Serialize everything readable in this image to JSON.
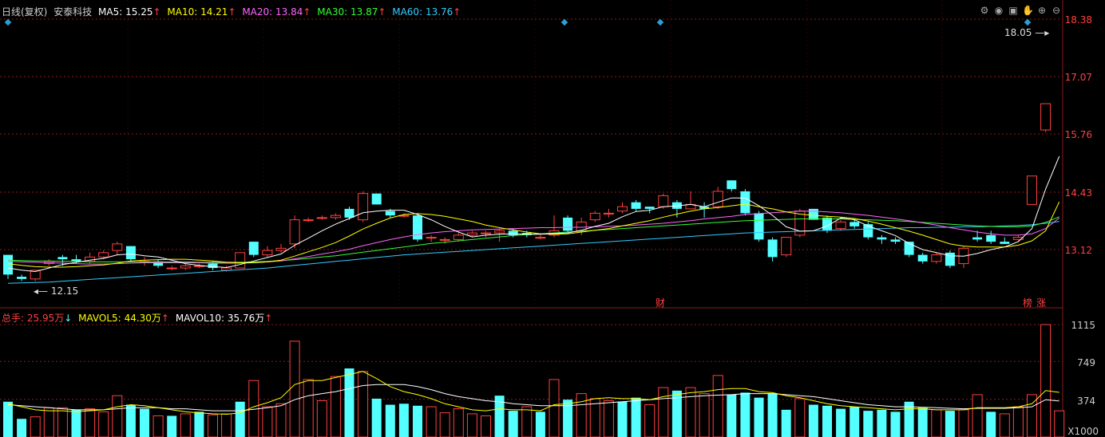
{
  "header": {
    "period_label": "日线(复权)",
    "stock_name": "安泰科技",
    "ma5": {
      "label": "MA5:",
      "value": "15.25",
      "arrow": "↑",
      "color": "#ffffff"
    },
    "ma10": {
      "label": "MA10:",
      "value": "14.21",
      "arrow": "↑",
      "color": "#ffff00"
    },
    "ma20": {
      "label": "MA20:",
      "value": "13.84",
      "arrow": "↑",
      "color": "#ff66ff"
    },
    "ma30": {
      "label": "MA30:",
      "value": "13.87",
      "arrow": "↑",
      "color": "#33ff33"
    },
    "ma60": {
      "label": "MA60:",
      "value": "13.76",
      "arrow": "↑",
      "color": "#33ccff"
    }
  },
  "vol_header": {
    "total": {
      "label": "总手:",
      "value": "25.95万",
      "arrow": "↓",
      "color": "#ff4040"
    },
    "mavol5": {
      "label": "MAVOL5:",
      "value": "44.30万",
      "arrow": "↑",
      "color": "#ffff00"
    },
    "mavol10": {
      "label": "MAVOL10:",
      "value": "35.76万",
      "arrow": "↑",
      "color": "#ffffff"
    }
  },
  "toolbar_icons": [
    "gear-icon",
    "eye-icon",
    "box-icon",
    "hand-icon",
    "zoom-in-icon",
    "zoom-out-icon"
  ],
  "markers": {
    "cai": "财",
    "bang": "榜",
    "zhang": "涨"
  },
  "annotations": {
    "high": "18.05",
    "low": "12.15"
  },
  "chart_data": {
    "type": "candlestick",
    "price_axis": {
      "min": 12.15,
      "max": 18.38,
      "ticks": [
        18.38,
        17.07,
        15.76,
        14.43,
        13.12
      ]
    },
    "volume_axis": {
      "min": 0,
      "max": 1115,
      "ticks": [
        1115,
        749,
        374
      ],
      "unit": "X1000"
    },
    "colors": {
      "up": "#ff4040",
      "down": "#54ffff",
      "ma5": "#ffffff",
      "ma10": "#ffff00",
      "ma20": "#ff66ff",
      "ma30": "#33ff33",
      "ma60": "#33ccff",
      "grid": "#8b1a1a"
    },
    "candles": [
      [
        13.0,
        12.55,
        13.0,
        12.45
      ],
      [
        12.5,
        12.45,
        12.55,
        12.4
      ],
      [
        12.45,
        12.65,
        12.65,
        12.4
      ],
      [
        12.8,
        12.85,
        12.9,
        12.75
      ],
      [
        12.95,
        12.9,
        13.0,
        12.75
      ],
      [
        12.9,
        12.85,
        13.0,
        12.8
      ],
      [
        12.85,
        12.95,
        13.05,
        12.8
      ],
      [
        12.95,
        13.05,
        13.1,
        12.9
      ],
      [
        13.1,
        13.25,
        13.3,
        13.0
      ],
      [
        13.2,
        12.9,
        13.2,
        12.85
      ],
      [
        12.85,
        12.85,
        12.95,
        12.75
      ],
      [
        12.85,
        12.75,
        12.9,
        12.7
      ],
      [
        12.7,
        12.7,
        12.75,
        12.65
      ],
      [
        12.7,
        12.75,
        12.8,
        12.65
      ],
      [
        12.75,
        12.75,
        12.8,
        12.7
      ],
      [
        12.8,
        12.7,
        12.85,
        12.65
      ],
      [
        12.65,
        12.7,
        12.75,
        12.62
      ],
      [
        12.7,
        13.05,
        13.05,
        12.7
      ],
      [
        13.3,
        13.0,
        13.3,
        12.95
      ],
      [
        13.0,
        13.1,
        13.2,
        12.95
      ],
      [
        13.1,
        13.15,
        13.25,
        13.05
      ],
      [
        13.25,
        13.8,
        13.9,
        13.15
      ],
      [
        13.8,
        13.8,
        13.85,
        13.75
      ],
      [
        13.85,
        13.85,
        13.9,
        13.8
      ],
      [
        13.85,
        13.9,
        13.95,
        13.8
      ],
      [
        14.05,
        13.85,
        14.1,
        13.8
      ],
      [
        13.8,
        14.4,
        14.45,
        13.75
      ],
      [
        14.4,
        14.15,
        14.4,
        14.15
      ],
      [
        14.0,
        13.9,
        14.05,
        13.85
      ],
      [
        13.9,
        13.9,
        13.95,
        13.85
      ],
      [
        13.9,
        13.35,
        13.95,
        13.3
      ],
      [
        13.4,
        13.4,
        13.45,
        13.3
      ],
      [
        13.35,
        13.35,
        13.4,
        13.25
      ],
      [
        13.35,
        13.45,
        13.5,
        13.3
      ],
      [
        13.45,
        13.5,
        13.55,
        13.4
      ],
      [
        13.5,
        13.5,
        13.55,
        13.4
      ],
      [
        13.5,
        13.55,
        13.6,
        13.3
      ],
      [
        13.55,
        13.45,
        13.6,
        13.4
      ],
      [
        13.5,
        13.45,
        13.55,
        13.4
      ],
      [
        13.4,
        13.4,
        13.45,
        13.35
      ],
      [
        13.45,
        13.55,
        13.9,
        13.4
      ],
      [
        13.85,
        13.55,
        13.9,
        13.5
      ],
      [
        13.55,
        13.75,
        13.85,
        13.45
      ],
      [
        13.8,
        13.95,
        14.0,
        13.75
      ],
      [
        13.95,
        13.95,
        14.05,
        13.85
      ],
      [
        14.0,
        14.1,
        14.2,
        13.95
      ],
      [
        14.2,
        14.05,
        14.25,
        14.0
      ],
      [
        14.1,
        14.05,
        14.1,
        13.95
      ],
      [
        14.1,
        14.35,
        14.4,
        14.05
      ],
      [
        14.2,
        14.05,
        14.25,
        13.85
      ],
      [
        14.05,
        14.15,
        14.45,
        14.05
      ],
      [
        14.1,
        14.05,
        14.2,
        13.85
      ],
      [
        14.1,
        14.45,
        14.55,
        14.05
      ],
      [
        14.7,
        14.5,
        14.7,
        14.45
      ],
      [
        14.45,
        13.95,
        14.5,
        13.9
      ],
      [
        13.95,
        13.35,
        14.0,
        13.3
      ],
      [
        13.35,
        12.95,
        13.4,
        12.85
      ],
      [
        13.0,
        13.4,
        13.4,
        12.95
      ],
      [
        13.45,
        14.0,
        14.05,
        13.4
      ],
      [
        14.05,
        13.8,
        14.05,
        13.8
      ],
      [
        13.85,
        13.55,
        13.9,
        13.5
      ],
      [
        13.6,
        13.75,
        13.8,
        13.55
      ],
      [
        13.75,
        13.65,
        13.8,
        13.6
      ],
      [
        13.7,
        13.4,
        13.75,
        13.35
      ],
      [
        13.4,
        13.35,
        13.45,
        13.25
      ],
      [
        13.35,
        13.3,
        13.4,
        13.25
      ],
      [
        13.3,
        13.0,
        13.3,
        12.95
      ],
      [
        13.0,
        12.85,
        13.05,
        12.8
      ],
      [
        12.85,
        13.0,
        13.05,
        12.8
      ],
      [
        13.05,
        12.75,
        13.1,
        12.7
      ],
      [
        12.8,
        13.15,
        13.2,
        12.7
      ],
      [
        13.4,
        13.35,
        13.55,
        13.3
      ],
      [
        13.45,
        13.3,
        13.55,
        13.25
      ],
      [
        13.3,
        13.25,
        13.4,
        13.25
      ],
      [
        13.35,
        13.4,
        13.45,
        13.3
      ],
      [
        14.15,
        14.8,
        14.8,
        14.15
      ],
      [
        15.85,
        16.45,
        16.45,
        15.8
      ]
    ],
    "volumes": [
      [
        350,
        0
      ],
      [
        180,
        0
      ],
      [
        200,
        1
      ],
      [
        290,
        1
      ],
      [
        290,
        1
      ],
      [
        270,
        0
      ],
      [
        280,
        1
      ],
      [
        250,
        1
      ],
      [
        410,
        1
      ],
      [
        320,
        0
      ],
      [
        280,
        0
      ],
      [
        210,
        1
      ],
      [
        210,
        0
      ],
      [
        230,
        1
      ],
      [
        250,
        0
      ],
      [
        220,
        1
      ],
      [
        230,
        1
      ],
      [
        350,
        0
      ],
      [
        560,
        1
      ],
      [
        300,
        1
      ],
      [
        330,
        1
      ],
      [
        950,
        1
      ],
      [
        570,
        1
      ],
      [
        360,
        1
      ],
      [
        600,
        1
      ],
      [
        680,
        0
      ],
      [
        650,
        1
      ],
      [
        380,
        0
      ],
      [
        320,
        0
      ],
      [
        330,
        0
      ],
      [
        310,
        0
      ],
      [
        300,
        1
      ],
      [
        240,
        1
      ],
      [
        280,
        1
      ],
      [
        230,
        1
      ],
      [
        210,
        1
      ],
      [
        410,
        0
      ],
      [
        260,
        0
      ],
      [
        300,
        1
      ],
      [
        250,
        0
      ],
      [
        570,
        1
      ],
      [
        370,
        0
      ],
      [
        430,
        1
      ],
      [
        380,
        1
      ],
      [
        360,
        1
      ],
      [
        350,
        0
      ],
      [
        390,
        0
      ],
      [
        320,
        1
      ],
      [
        490,
        1
      ],
      [
        460,
        0
      ],
      [
        490,
        1
      ],
      [
        430,
        1
      ],
      [
        610,
        1
      ],
      [
        420,
        0
      ],
      [
        440,
        0
      ],
      [
        390,
        0
      ],
      [
        430,
        0
      ],
      [
        270,
        0
      ],
      [
        380,
        1
      ],
      [
        320,
        0
      ],
      [
        310,
        0
      ],
      [
        280,
        0
      ],
      [
        300,
        0
      ],
      [
        260,
        0
      ],
      [
        270,
        0
      ],
      [
        250,
        0
      ],
      [
        350,
        0
      ],
      [
        290,
        0
      ],
      [
        270,
        1
      ],
      [
        260,
        0
      ],
      [
        270,
        1
      ],
      [
        420,
        1
      ],
      [
        250,
        0
      ],
      [
        230,
        1
      ],
      [
        300,
        1
      ],
      [
        420,
        1
      ],
      [
        1115,
        1
      ],
      [
        260,
        1
      ]
    ],
    "ma": {
      "ma5": [
        12.7,
        12.65,
        12.62,
        12.7,
        12.78,
        12.83,
        12.88,
        12.92,
        13.0,
        13.02,
        12.98,
        12.95,
        12.88,
        12.8,
        12.76,
        12.73,
        12.71,
        12.78,
        12.86,
        12.94,
        13.02,
        13.22,
        13.38,
        13.55,
        13.7,
        13.83,
        13.96,
        14.0,
        14.02,
        14.02,
        13.92,
        13.8,
        13.65,
        13.52,
        13.41,
        13.45,
        13.47,
        13.48,
        13.47,
        13.47,
        13.49,
        13.5,
        13.56,
        13.65,
        13.72,
        13.87,
        13.99,
        14.02,
        14.1,
        14.12,
        14.15,
        14.1,
        14.2,
        14.3,
        14.3,
        14.12,
        13.9,
        13.64,
        13.54,
        13.55,
        13.66,
        13.84,
        13.8,
        13.66,
        13.55,
        13.44,
        13.26,
        13.12,
        13.05,
        12.98,
        12.97,
        13.03,
        13.12,
        13.18,
        13.3,
        13.6,
        14.5,
        15.25
      ],
      "ma10": [
        12.8,
        12.76,
        12.73,
        12.72,
        12.72,
        12.73,
        12.75,
        12.77,
        12.81,
        12.86,
        12.88,
        12.89,
        12.9,
        12.9,
        12.88,
        12.86,
        12.83,
        12.82,
        12.82,
        12.84,
        12.88,
        12.97,
        13.07,
        13.17,
        13.28,
        13.43,
        13.59,
        13.72,
        13.84,
        13.92,
        13.94,
        13.92,
        13.88,
        13.82,
        13.76,
        13.68,
        13.62,
        13.57,
        13.52,
        13.48,
        13.47,
        13.48,
        13.52,
        13.56,
        13.6,
        13.66,
        13.72,
        13.78,
        13.86,
        13.93,
        14.0,
        14.05,
        14.08,
        14.12,
        14.16,
        14.1,
        14.05,
        13.98,
        13.93,
        13.9,
        13.88,
        13.86,
        13.83,
        13.77,
        13.7,
        13.62,
        13.54,
        13.45,
        13.35,
        13.25,
        13.2,
        13.18,
        13.18,
        13.18,
        13.22,
        13.32,
        13.55,
        14.21
      ],
      "ma20": [
        12.85,
        12.84,
        12.83,
        12.82,
        12.81,
        12.8,
        12.79,
        12.79,
        12.8,
        12.81,
        12.82,
        12.82,
        12.82,
        12.82,
        12.82,
        12.81,
        12.81,
        12.81,
        12.82,
        12.84,
        12.86,
        12.91,
        12.96,
        13.02,
        13.07,
        13.13,
        13.21,
        13.28,
        13.35,
        13.41,
        13.46,
        13.5,
        13.53,
        13.55,
        13.57,
        13.58,
        13.59,
        13.6,
        13.61,
        13.62,
        13.62,
        13.63,
        13.63,
        13.64,
        13.65,
        13.66,
        13.68,
        13.7,
        13.72,
        13.75,
        13.78,
        13.82,
        13.85,
        13.88,
        13.92,
        13.94,
        13.96,
        13.98,
        14.0,
        14.0,
        13.98,
        13.96,
        13.93,
        13.9,
        13.86,
        13.82,
        13.78,
        13.73,
        13.68,
        13.62,
        13.57,
        13.52,
        13.48,
        13.45,
        13.45,
        13.48,
        13.6,
        13.84
      ],
      "ma30": [
        12.88,
        12.87,
        12.86,
        12.86,
        12.85,
        12.85,
        12.84,
        12.84,
        12.84,
        12.84,
        12.84,
        12.84,
        12.84,
        12.84,
        12.83,
        12.83,
        12.83,
        12.83,
        12.84,
        12.85,
        12.87,
        12.89,
        12.92,
        12.95,
        12.98,
        13.02,
        13.06,
        13.1,
        13.14,
        13.18,
        13.22,
        13.26,
        13.29,
        13.32,
        13.35,
        13.38,
        13.41,
        13.44,
        13.46,
        13.48,
        13.5,
        13.52,
        13.54,
        13.56,
        13.58,
        13.6,
        13.62,
        13.64,
        13.66,
        13.68,
        13.7,
        13.72,
        13.74,
        13.76,
        13.78,
        13.79,
        13.8,
        13.81,
        13.82,
        13.82,
        13.82,
        13.82,
        13.81,
        13.8,
        13.79,
        13.78,
        13.76,
        13.74,
        13.72,
        13.7,
        13.68,
        13.66,
        13.65,
        13.64,
        13.64,
        13.66,
        13.74,
        13.87
      ],
      "ma60": [
        12.35,
        12.36,
        12.37,
        12.38,
        12.4,
        12.42,
        12.44,
        12.46,
        12.48,
        12.5,
        12.52,
        12.54,
        12.56,
        12.58,
        12.6,
        12.62,
        12.64,
        12.66,
        12.68,
        12.7,
        12.73,
        12.76,
        12.79,
        12.82,
        12.85,
        12.88,
        12.91,
        12.94,
        12.97,
        13.0,
        13.02,
        13.04,
        13.06,
        13.08,
        13.1,
        13.12,
        13.14,
        13.16,
        13.18,
        13.2,
        13.22,
        13.24,
        13.26,
        13.28,
        13.3,
        13.32,
        13.34,
        13.36,
        13.38,
        13.4,
        13.42,
        13.44,
        13.46,
        13.48,
        13.5,
        13.51,
        13.52,
        13.53,
        13.54,
        13.55,
        13.56,
        13.57,
        13.58,
        13.59,
        13.6,
        13.61,
        13.62,
        13.62,
        13.63,
        13.63,
        13.64,
        13.64,
        13.65,
        13.66,
        13.67,
        13.69,
        13.72,
        13.76
      ]
    },
    "mavol": {
      "mavol5": [
        330,
        300,
        270,
        260,
        260,
        250,
        260,
        270,
        300,
        320,
        310,
        290,
        270,
        250,
        240,
        230,
        225,
        240,
        300,
        340,
        390,
        520,
        560,
        560,
        590,
        620,
        650,
        580,
        500,
        450,
        420,
        380,
        330,
        300,
        270,
        260,
        280,
        270,
        270,
        260,
        320,
        330,
        350,
        380,
        390,
        380,
        380,
        370,
        400,
        420,
        440,
        450,
        470,
        480,
        480,
        450,
        440,
        410,
        390,
        360,
        330,
        310,
        300,
        290,
        280,
        270,
        280,
        280,
        270,
        270,
        270,
        290,
        290,
        290,
        300,
        330,
        460,
        443
      ],
      "mavol10": [
        320,
        310,
        300,
        290,
        280,
        270,
        270,
        270,
        280,
        290,
        290,
        290,
        280,
        280,
        270,
        260,
        260,
        260,
        275,
        290,
        310,
        370,
        410,
        430,
        450,
        480,
        510,
        520,
        520,
        520,
        500,
        470,
        430,
        400,
        380,
        360,
        350,
        330,
        320,
        310,
        310,
        310,
        320,
        330,
        340,
        350,
        360,
        370,
        380,
        390,
        400,
        410,
        415,
        420,
        430,
        430,
        430,
        420,
        410,
        400,
        380,
        360,
        340,
        320,
        310,
        300,
        300,
        295,
        290,
        285,
        280,
        285,
        285,
        285,
        290,
        300,
        370,
        357
      ]
    }
  }
}
